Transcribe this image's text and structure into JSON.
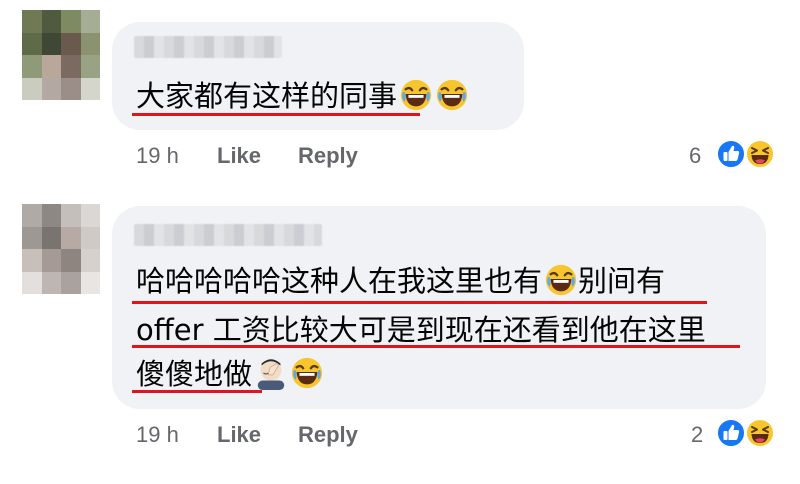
{
  "comments": [
    {
      "lines": [
        "大家都有这样的同事"
      ],
      "time": "19 h",
      "like_label": "Like",
      "reply_label": "Reply",
      "reaction_count": "6",
      "reactions": [
        "like-icon",
        "haha-icon"
      ]
    },
    {
      "lines": [
        "哈哈哈哈哈这种人在我这里也有",
        "别间有",
        "offer 工资比较大可是到现在还看到他在这里",
        "傻傻地做"
      ],
      "time": "19 h",
      "like_label": "Like",
      "reply_label": "Reply",
      "reaction_count": "2",
      "reactions": [
        "like-icon",
        "haha-icon"
      ]
    }
  ],
  "colors": {
    "bubble": "#f0f2f5",
    "underline": "#e0141b",
    "meta": "#65676b",
    "like_blue": "#1877f2",
    "haha_yellow": "#f7c62f"
  }
}
